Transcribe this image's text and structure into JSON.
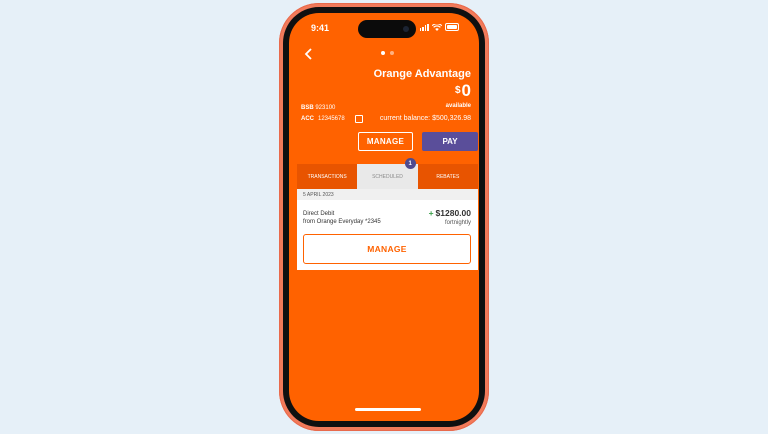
{
  "status_bar": {
    "time": "9:41"
  },
  "header": {
    "account_name": "Orange Advantage",
    "balance_currency": "$",
    "balance_amount": "0",
    "balance_label": "available",
    "bsb_label": "BSB",
    "bsb_value": "923100",
    "acc_label": "ACC",
    "acc_value": "12345678",
    "current_balance": "current balance: $500,326.98"
  },
  "actions": {
    "manage_label": "MANAGE",
    "pay_label": "PAY"
  },
  "tabs": [
    {
      "label": "TRANSACTIONS"
    },
    {
      "label": "SCHEDULED",
      "badge": "1"
    },
    {
      "label": "REBATES"
    }
  ],
  "scheduled": {
    "date": "5 APRIL 2023",
    "description_line1": "Direct Debit",
    "description_line2": "from Orange Everyday *2345",
    "amount_sign": "+",
    "amount": "$1280.00",
    "frequency": "fortnightly",
    "manage_label": "MANAGE"
  },
  "colors": {
    "brand": "#ff6200",
    "pay": "#5a4e9a",
    "badge": "#4e4a8e",
    "background": "#e6f0f8"
  }
}
